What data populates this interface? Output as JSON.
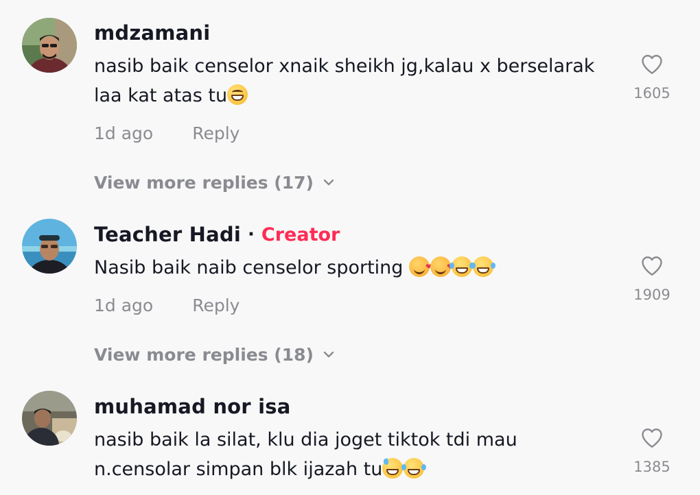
{
  "comments": [
    {
      "username": "mdzamani",
      "is_creator": false,
      "text_line1": "nasib baik censelor xnaik sheikh jg,kalau x berselarak",
      "text_line2": "laa kat atas tu",
      "emojis": [
        "grinning-emoji"
      ],
      "time": "1d ago",
      "reply_label": "Reply",
      "view_more": "View more replies (17)",
      "likes": "1605"
    },
    {
      "username": "Teacher Hadi",
      "dot": "·",
      "creator_label": "Creator",
      "is_creator": true,
      "text_line1": "Nasib baik naib censelor sporting ",
      "emojis": [
        "smiling-face-with-hearts-emoji",
        "smiling-face-with-hearts-emoji",
        "tears-of-joy-emoji",
        "tears-of-joy-emoji"
      ],
      "time": "1d ago",
      "reply_label": "Reply",
      "view_more": "View more replies (18)",
      "likes": "1909"
    },
    {
      "username": "muhamad nor isa",
      "is_creator": false,
      "text_line1": "nasib baik la silat, klu dia joget tiktok tdi mau",
      "text_line2": "n.censolar simpan blk ijazah tu",
      "emojis": [
        "sweat-smile-emoji",
        "tears-of-joy-emoji"
      ],
      "likes": "1385"
    }
  ],
  "colors": {
    "background": "#f8f8f8",
    "text": "#161823",
    "muted": "#8a8b91",
    "creator": "#fe2c55"
  }
}
